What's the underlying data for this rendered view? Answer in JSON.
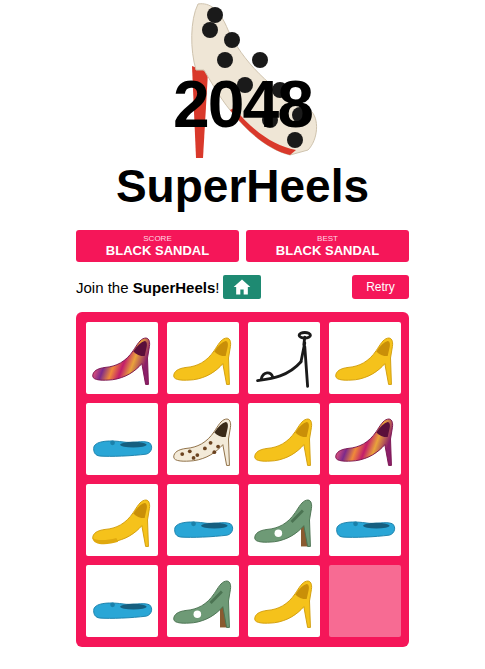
{
  "title": "2048",
  "subtitle": "SuperHeels",
  "scores": [
    {
      "label": "SCORE",
      "value": "BLACK SANDAL"
    },
    {
      "label": "BEST",
      "value": "BLACK SANDAL"
    }
  ],
  "tagline": {
    "before": "Join the ",
    "brand": "SuperHeels",
    "after": "!"
  },
  "retry": "Retry",
  "tiles": [
    {
      "kind": "striped-pump"
    },
    {
      "kind": "yellow-pump"
    },
    {
      "kind": "black-sandal"
    },
    {
      "kind": "yellow-pump"
    },
    {
      "kind": "blue-flat"
    },
    {
      "kind": "leopard-pump"
    },
    {
      "kind": "yellow-pump"
    },
    {
      "kind": "striped-pump"
    },
    {
      "kind": "yellow-platform"
    },
    {
      "kind": "blue-flat"
    },
    {
      "kind": "green-sandal"
    },
    {
      "kind": "blue-flat"
    },
    {
      "kind": "blue-flat"
    },
    {
      "kind": "green-sandal"
    },
    {
      "kind": "yellow-pump"
    },
    {
      "kind": "empty"
    }
  ]
}
